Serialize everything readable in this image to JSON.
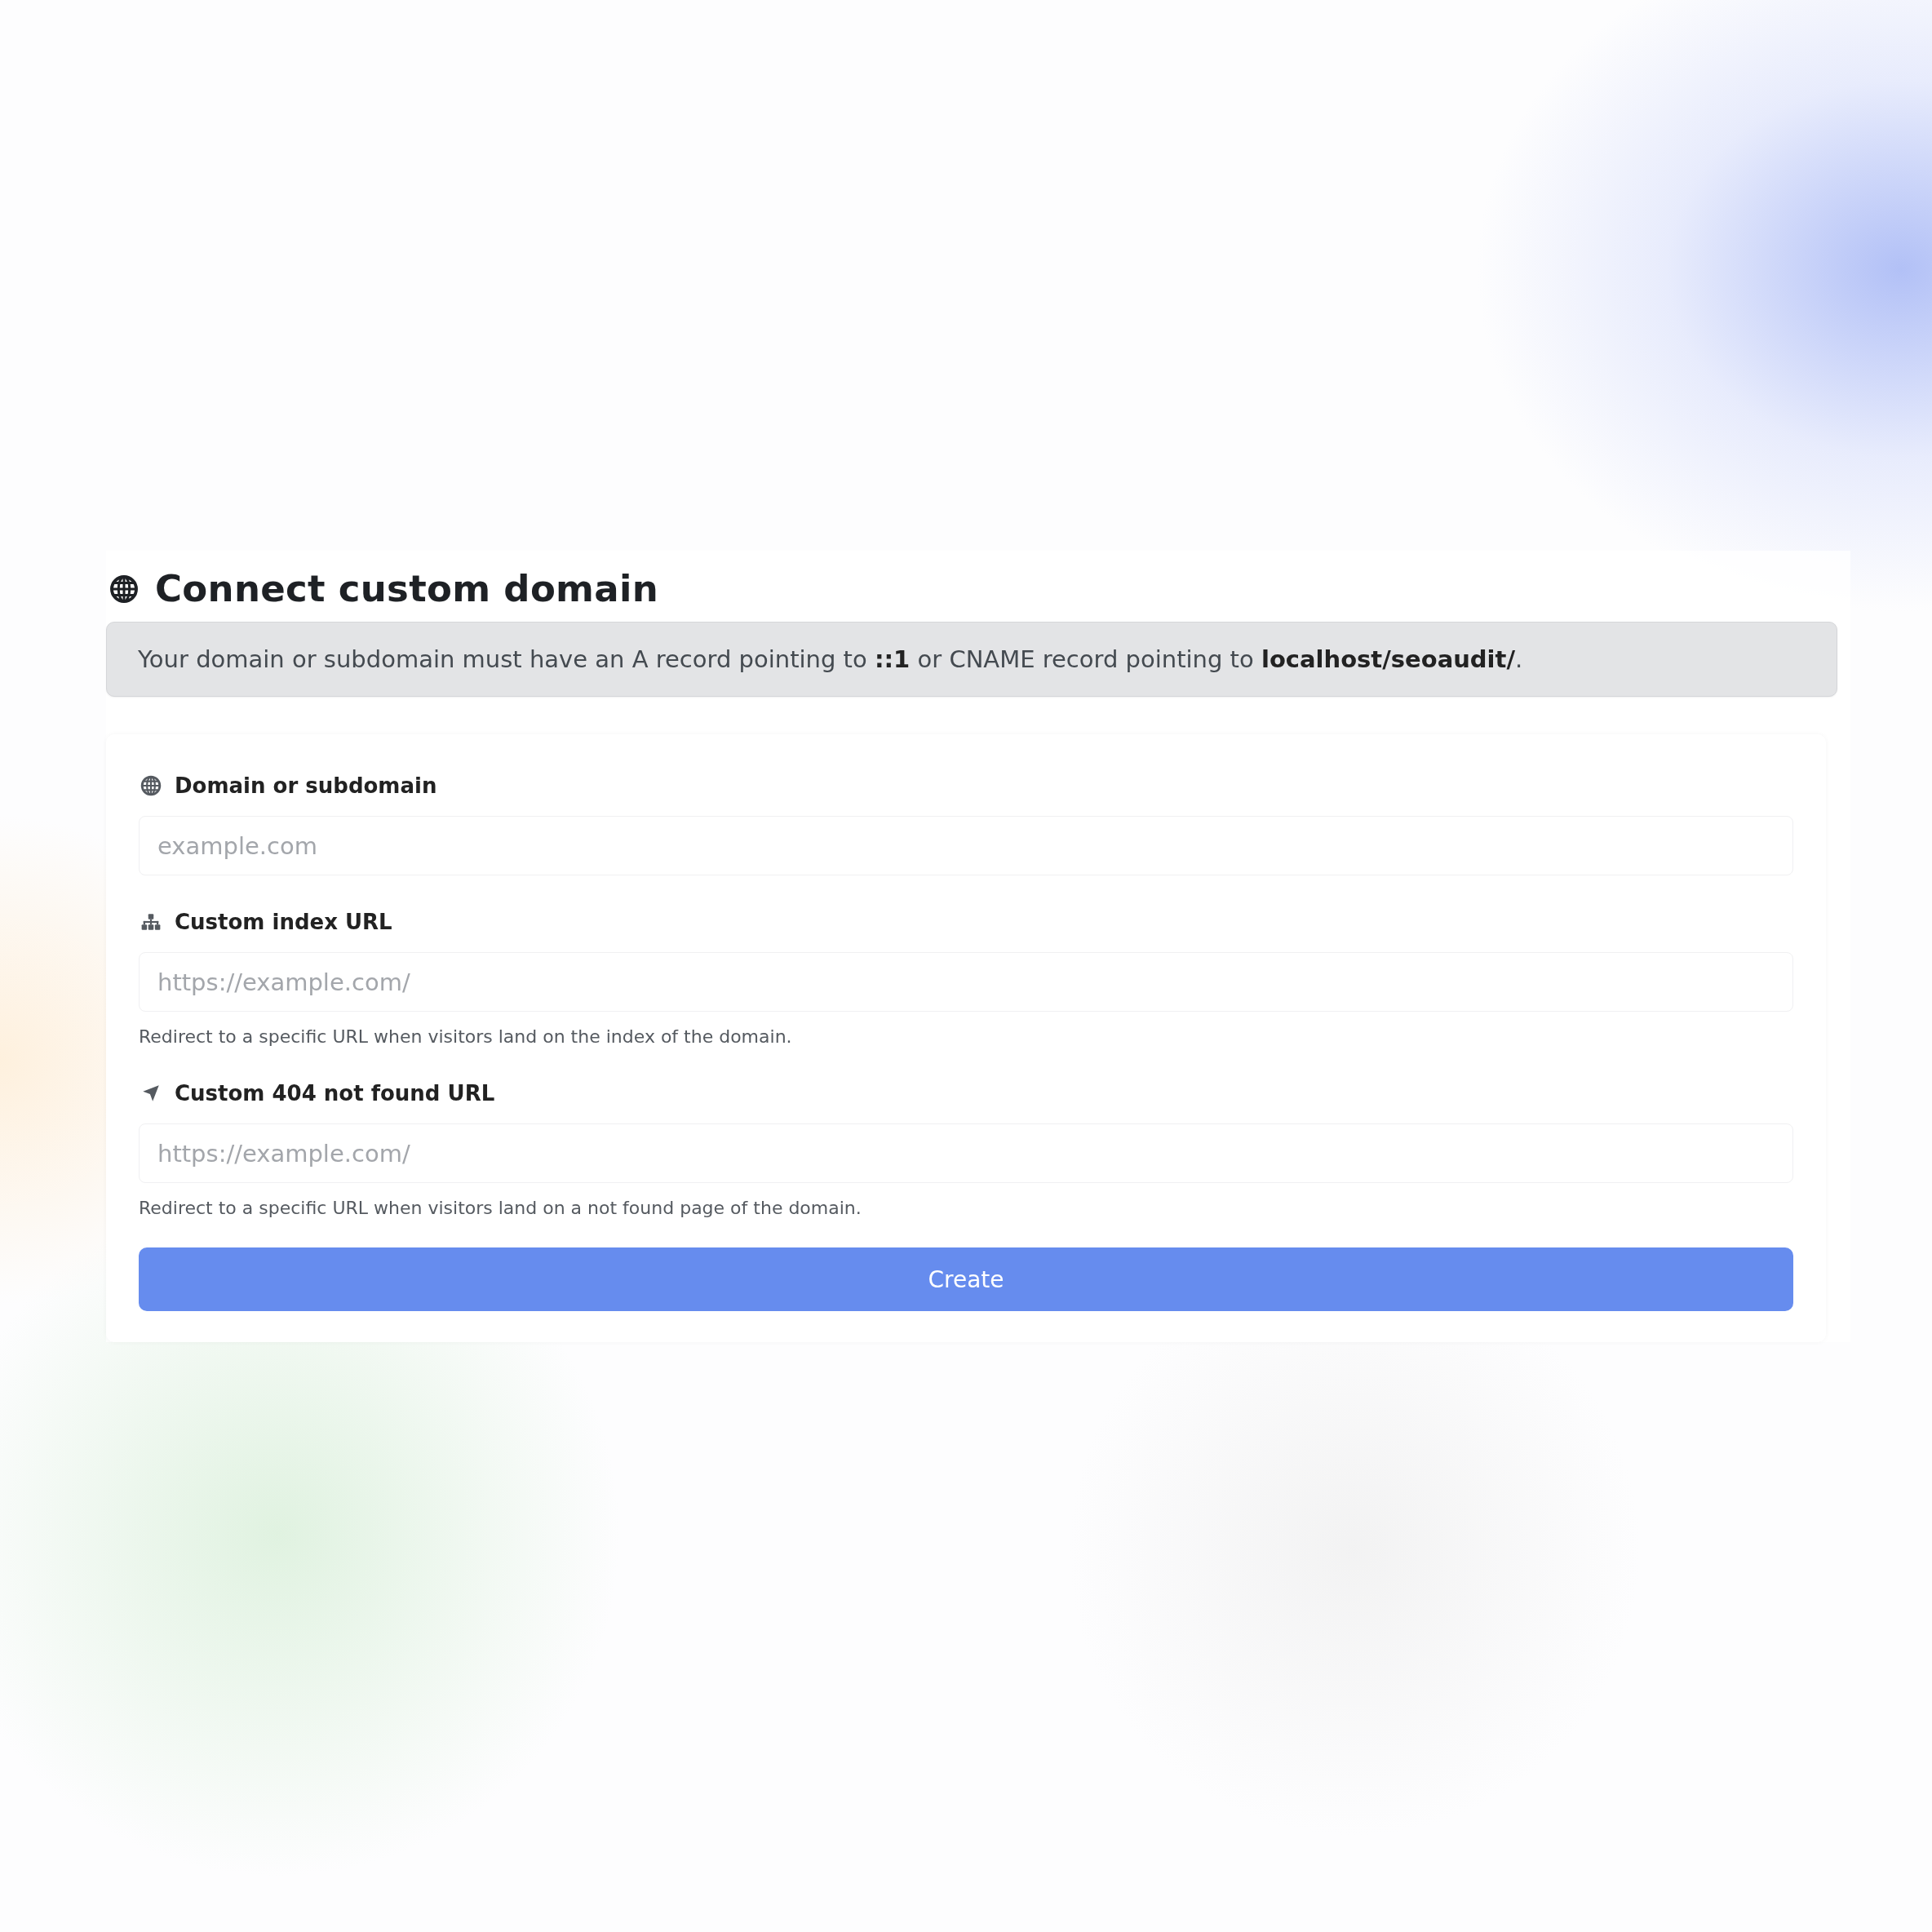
{
  "title": "Connect custom domain",
  "notice": "Your domain or subdomain must have an A record pointing to **::1** or CNAME record pointing to **localhost/seoaudit/**.",
  "fields": [
    {
      "label": "Domain or subdomain",
      "placeholder": "example.com"
    },
    {
      "label": "Custom index URL",
      "placeholder": "https://example.com/",
      "help": "Redirect to a specific URL when visitors land on the index of the domain."
    },
    {
      "label": "Custom 404 not found URL",
      "placeholder": "https://example.com/",
      "help": "Redirect to a specific URL when visitors land on a not found page of the domain."
    }
  ],
  "button": "Create"
}
